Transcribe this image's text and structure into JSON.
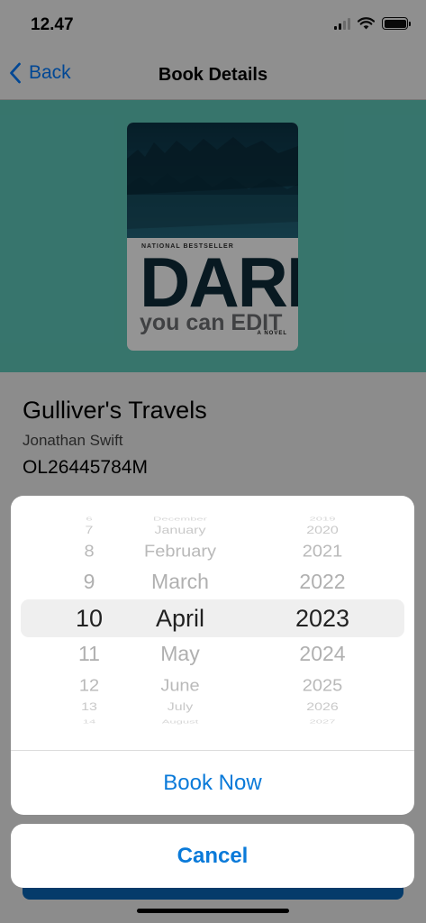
{
  "status_bar": {
    "time": "12.47"
  },
  "nav": {
    "back_label": "Back",
    "title": "Book Details"
  },
  "cover": {
    "kicker": "NATIONAL BESTSELLER",
    "title": "DARK",
    "subtitle": "you can EDIT",
    "tag": "A NOVEL"
  },
  "book": {
    "title": "Gulliver's Travels",
    "author": "Jonathan Swift",
    "id": "OL26445784M"
  },
  "picker": {
    "days": [
      "6",
      "7",
      "8",
      "9",
      "10",
      "11",
      "12",
      "13",
      "14"
    ],
    "months": [
      "December",
      "January",
      "February",
      "March",
      "April",
      "May",
      "June",
      "July",
      "August"
    ],
    "years": [
      "2019",
      "2020",
      "2021",
      "2022",
      "2023",
      "2024",
      "2025",
      "2026",
      "2027"
    ],
    "selected": {
      "day": "10",
      "month": "April",
      "year": "2023"
    }
  },
  "actions": {
    "book_now": "Book Now",
    "cancel": "Cancel"
  },
  "colors": {
    "accent": "#0a7ad9",
    "cover_band": "#5fcabb",
    "back_link": "#007aff"
  }
}
